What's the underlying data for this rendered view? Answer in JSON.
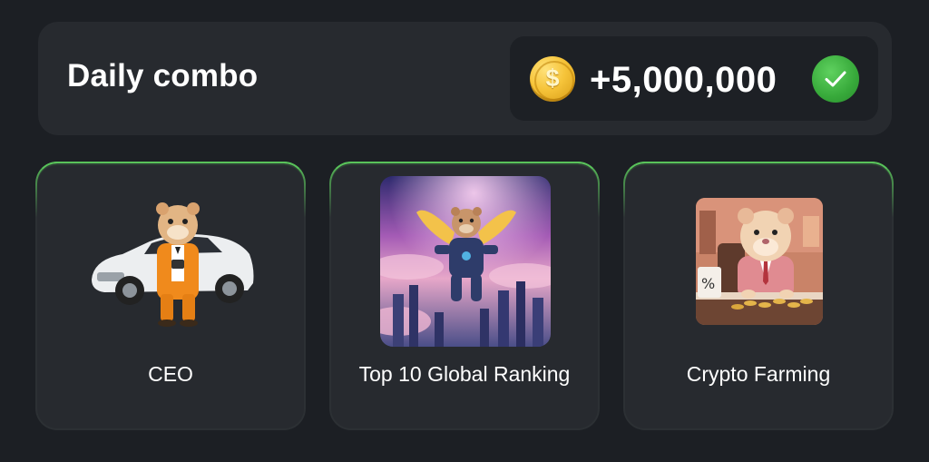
{
  "daily_combo": {
    "title": "Daily combo",
    "reward": "+5,000,000",
    "coin_symbol": "$",
    "claimed": true
  },
  "cards": [
    {
      "label": "CEO",
      "image_icon": "hamster-ceo-car-image"
    },
    {
      "label": "Top 10 Global Ranking",
      "image_icon": "hamster-flying-city-image"
    },
    {
      "label": "Crypto Farming",
      "image_icon": "hamster-office-coins-image"
    }
  ],
  "colors": {
    "background": "#1c1f24",
    "panel": "#272a2f",
    "accent_green": "#59c25a",
    "coin_gold": "#f6c43a"
  }
}
